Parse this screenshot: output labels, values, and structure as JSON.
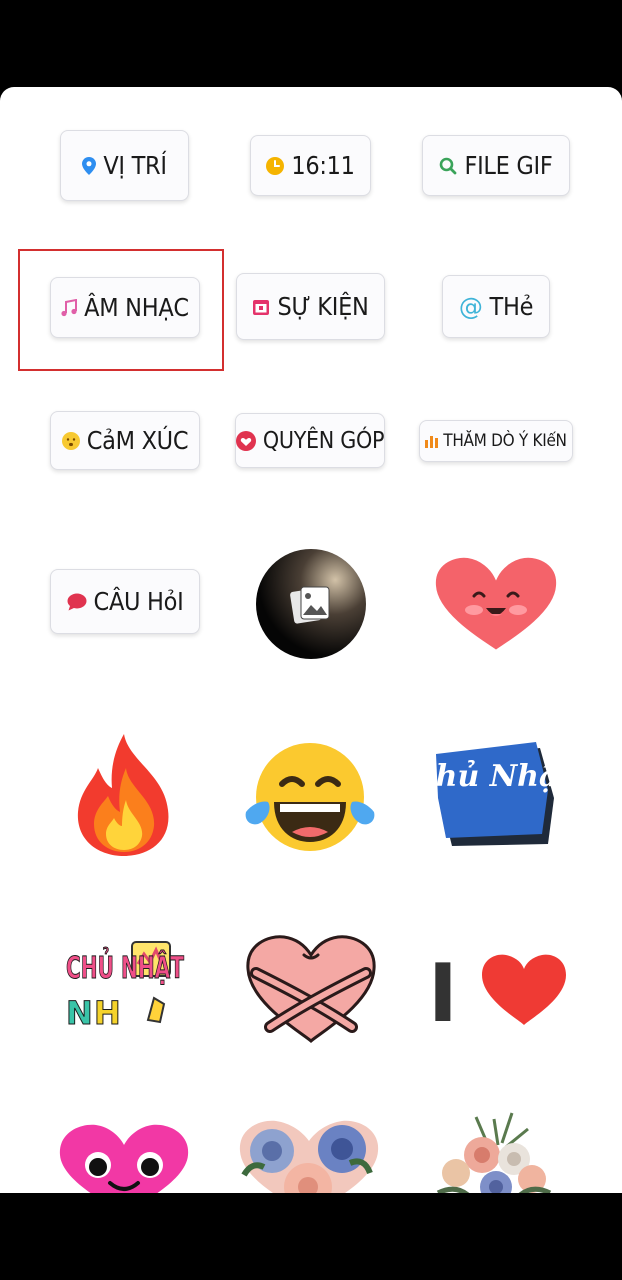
{
  "chips": {
    "location": "VỊ TRÍ",
    "time": "16:11",
    "gif": "FILE GIF",
    "music": "ÂM NHẠC",
    "event": "SỰ KIỆN",
    "mention": "THẻ",
    "emoji_slider": "CảM XÚC",
    "donation": "QUYÊN GÓP",
    "poll": "THĂM DÒ Ý KIếN",
    "question": "CÂU HỏI"
  },
  "stickers": {
    "chu_nhat_blue": "Chủ Nhật",
    "chu_nhat_color": "CHỦ NHẬT",
    "i_love": "I"
  },
  "colors": {
    "highlight": "#d32f2f",
    "location": "#2e8ef0",
    "time": "#f5b400",
    "gif": "#3aa35a",
    "music": "#e05fa8",
    "event": "#e4336b",
    "mention": "#3fb4d8",
    "poll": "#f08a1a",
    "question": "#e0334f"
  }
}
